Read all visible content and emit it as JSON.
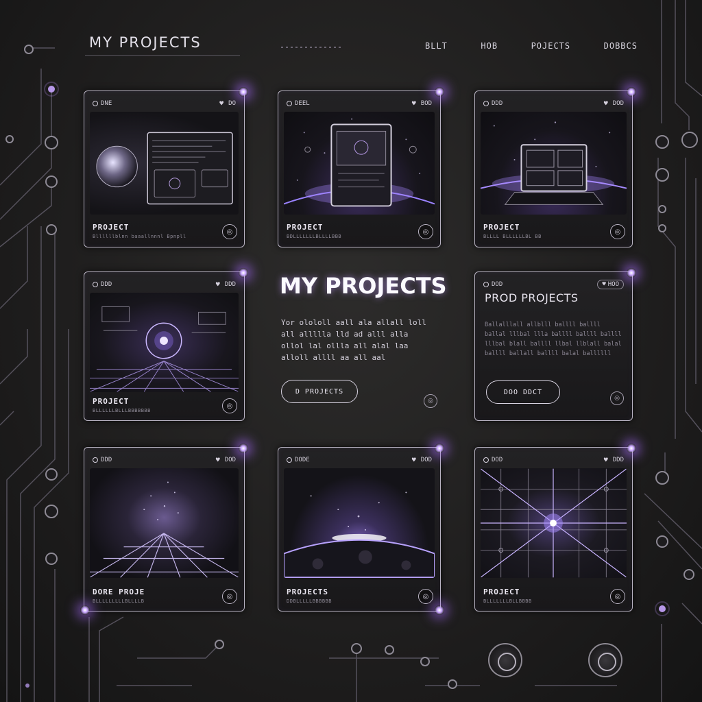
{
  "header": {
    "site_title": "MY PROJECTS",
    "nav": [
      "BLLT",
      "HOB",
      "POJECTS",
      "DOBBCS"
    ]
  },
  "cards": [
    {
      "tag_left": "DNE",
      "tag_right": "DO",
      "label": "PROJECT",
      "sub": "Bllllllblnn baaallnnnl Bpnpll"
    },
    {
      "tag_left": "DEEL",
      "tag_right": "BOD",
      "label": "PROJECT",
      "sub": "BDLLLLLLLBLLLLBBB"
    },
    {
      "tag_left": "DDD",
      "tag_right": "DOD",
      "label": "PROJECT",
      "sub": "BLLLL BLLLLLLBL BB"
    },
    {
      "tag_left": "DDD",
      "tag_right": "DDD",
      "label": "PROJECT",
      "sub": "BLLLLLLBLLLBBBBBBB"
    },
    {
      "tag_left": "DDD",
      "tag_right": "DOD",
      "label": "DORE PROJE",
      "sub": "BLLLLLLLLLBLLLLB"
    },
    {
      "tag_left": "DODE",
      "tag_right": "DOD",
      "label": "PROJECTS",
      "sub": "DDBLLLLLBBBBBB"
    },
    {
      "tag_left": "DOD",
      "tag_right": "DDD",
      "label": "PROJECT",
      "sub": "BLLLLLLLBLLBBBB"
    }
  ],
  "hero": {
    "title": "MY PROJECTS",
    "description": "Yor olololl aall ala allall loll all allllla lld ad alll alla ollol lal ollla all alal laa alloll allll aa all aal",
    "button": "D PROJECTS",
    "icon": "ring-icon"
  },
  "text_card": {
    "tag_left": "DOD",
    "badge": "HOO",
    "title": "PROD PROJECTS",
    "body": "Ballalllall allblll ballll ballll ballal lllbal llla ballll ballll ballll lllbal blall ballll llbal llblall balal ballll ballall ballll balal ballllll",
    "button": "DOO DDCT"
  },
  "colors": {
    "accent": "#b985ff",
    "background": "#1f1e1e",
    "border": "#b8b3c2"
  }
}
